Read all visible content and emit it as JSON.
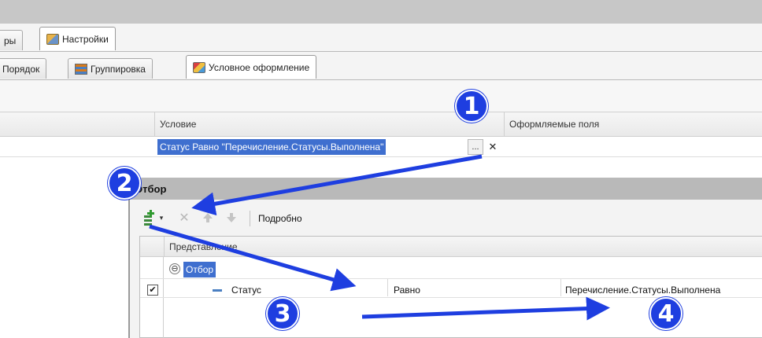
{
  "tabs_top": [
    {
      "label": "ры",
      "active": false
    },
    {
      "label": "Настройки",
      "active": true,
      "icon": "settings-icon"
    }
  ],
  "tabs_second": [
    {
      "label": "Порядок",
      "active": false
    },
    {
      "label": "Группировка",
      "active": false,
      "icon": "grouping-icon"
    },
    {
      "label": "Условное оформление",
      "active": true,
      "icon": "conditional-format-icon"
    }
  ],
  "upper_table": {
    "columns": [
      "Условие",
      "Оформляемые поля"
    ],
    "row": {
      "condition": "Статус Равно \"Перечисление.Статусы.Выполнена\"",
      "ellipsis_button": "...",
      "clear_button": "✕"
    }
  },
  "filter_panel": {
    "title": "Отбор",
    "toolbar": {
      "add_icon": "add-condition-icon",
      "delete_icon": "delete-icon",
      "move_up_icon": "arrow-up-icon",
      "move_down_icon": "arrow-down-icon",
      "details_label": "Подробно"
    },
    "grid": {
      "header": "Представление",
      "group_row": {
        "label": "Отбор",
        "collapse_glyph": "⊖"
      },
      "rows": [
        {
          "checked": true,
          "field": "Статус",
          "comparison": "Равно",
          "value": "Перечисление.Статусы.Выполнена"
        }
      ]
    }
  },
  "annotations": {
    "badges": [
      "1",
      "2",
      "3",
      "4"
    ],
    "arrow_color": "#1e3ee0"
  },
  "colors": {
    "selection": "#3f6fcf",
    "badge": "#1e3ee0"
  }
}
